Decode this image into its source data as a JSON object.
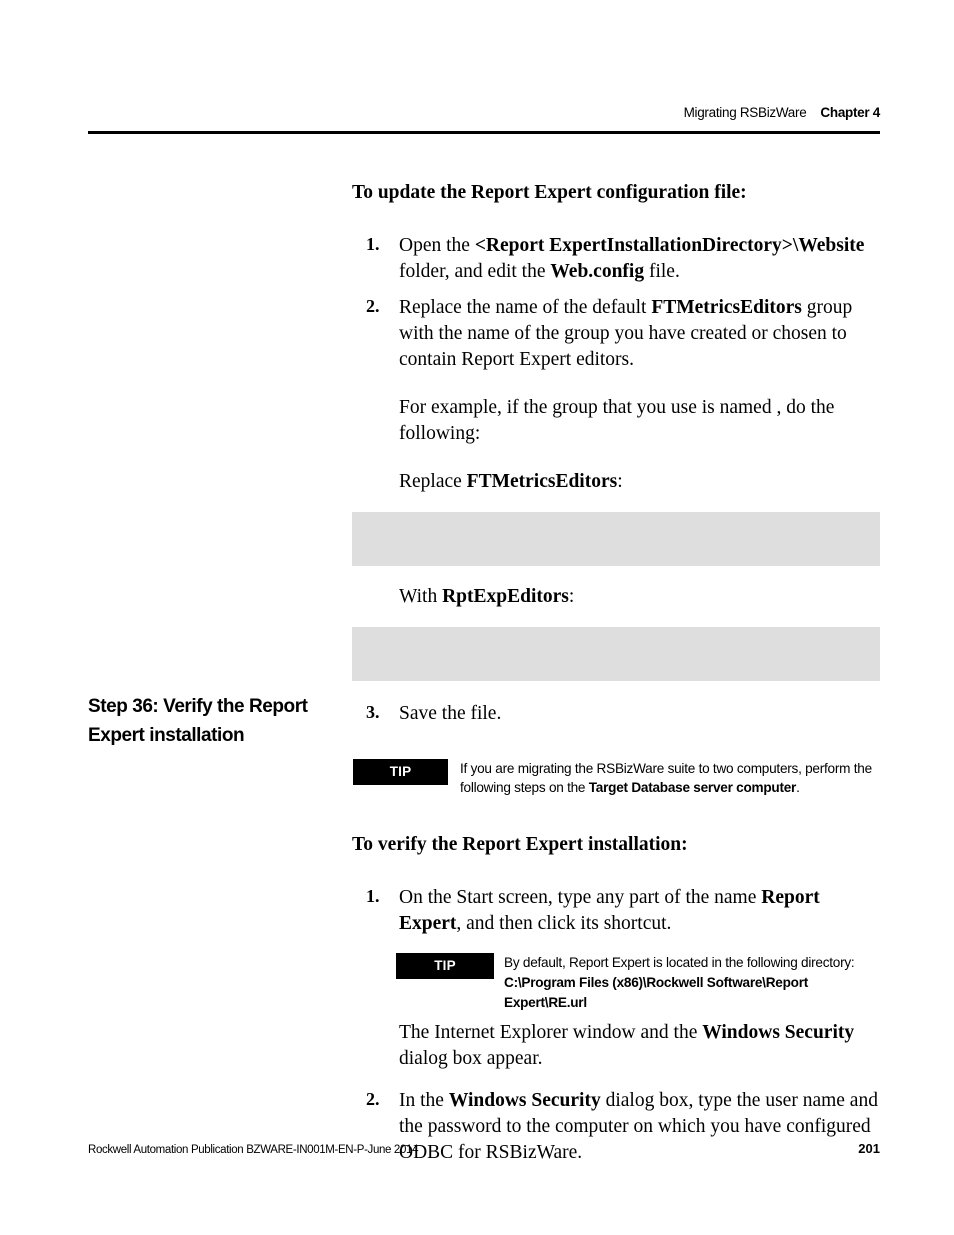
{
  "header": {
    "running_title": "Migrating RSBizWare",
    "chapter": "Chapter 4"
  },
  "margin_heading": {
    "line1": "Step 36: Verify the Report",
    "line2": "Expert installation",
    "full": "Step 36: Verify the Report Expert installation"
  },
  "section_a": {
    "heading": "To update the Report Expert configuration file:",
    "step1": {
      "num": "1.",
      "t1": "Open the ",
      "b1": "<Report ExpertInstallationDirectory>\\Website",
      "t2": " folder, and edit the ",
      "b2": "Web.config",
      "t3": " file."
    },
    "step2": {
      "num": "2.",
      "t1": "Replace the name of the default ",
      "b1": "FTMetricsEditors",
      "t2": " group with the name of the group you have created or chosen to contain Report Expert editors.",
      "example_t1": "For example, if the group that you use is named",
      "example_code": "",
      "example_t2": ", do the following:",
      "replace_label_t1": "Replace ",
      "replace_label_b": "FTMetricsEditors",
      "replace_label_t2": ":",
      "replace_code": "",
      "with_label_t1": "With ",
      "with_label_b": "RptExpEditors",
      "with_label_t2": ":",
      "with_code": ""
    },
    "step3": {
      "num": "3.",
      "t1": "Save the file."
    }
  },
  "tip1": {
    "label": "TIP",
    "t1": "If you are migrating the RSBizWare suite to two computers, perform the following steps on the ",
    "b1": "Target Database server computer",
    "t2": "."
  },
  "section_b": {
    "heading": "To verify the Report Expert installation:",
    "step1": {
      "num": "1.",
      "t1": "On the Start screen, type any part of the name ",
      "b1": "Report Expert",
      "t2": ", and then click its shortcut."
    },
    "tip2": {
      "label": "TIP",
      "t1": "By default, Report Expert is located in the following directory:",
      "b1": "C:\\Program Files (x86)\\Rockwell Software\\Report Expert\\RE.url"
    },
    "after_tip": {
      "t1": "The Internet Explorer window and the ",
      "b1": "Windows Security",
      "t2": " dialog box appear."
    },
    "step2": {
      "num": "2.",
      "t1": "In the ",
      "b1": "Windows Security",
      "t2": " dialog box, type the user name and the password to the computer on which you have configured ODBC for RSBizWare."
    }
  },
  "footer": {
    "publication": "Rockwell Automation Publication BZWARE-IN001M-EN-P-June 2014",
    "page_number": "201"
  },
  "colors": {
    "code_block_bg": "#dedede",
    "tip_label_bg": "#000000",
    "tip_label_fg": "#ffffff",
    "rule": "#000000"
  }
}
